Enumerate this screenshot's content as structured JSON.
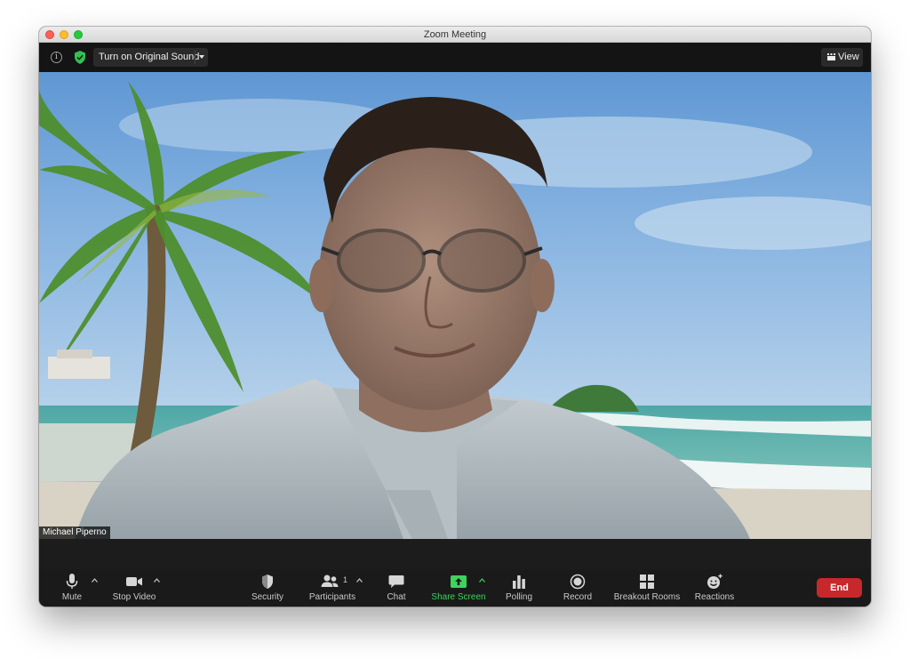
{
  "window": {
    "title": "Zoom Meeting"
  },
  "topbar": {
    "sound_label": "Turn on Original Sound",
    "view_label": "View",
    "info_glyph": "i"
  },
  "video": {
    "participant_name": "Michael Piperno"
  },
  "toolbar": {
    "mute": "Mute",
    "stop_video": "Stop Video",
    "security": "Security",
    "participants": "Participants",
    "participant_count": "1",
    "chat": "Chat",
    "share_screen": "Share Screen",
    "polling": "Polling",
    "record": "Record",
    "breakout_rooms": "Breakout Rooms",
    "reactions": "Reactions",
    "end": "End"
  },
  "colors": {
    "end_button": "#c7282c",
    "share_green": "#3ed35c",
    "toolbar_bg": "#1a1a1a"
  },
  "icons": [
    "info-icon",
    "shield-icon",
    "caret-down-icon",
    "grid-view-icon",
    "microphone-icon",
    "video-camera-icon",
    "shield-icon",
    "people-icon",
    "chat-bubble-icon",
    "share-screen-icon",
    "bar-chart-icon",
    "record-icon",
    "grid-icon",
    "emoji-icon"
  ]
}
